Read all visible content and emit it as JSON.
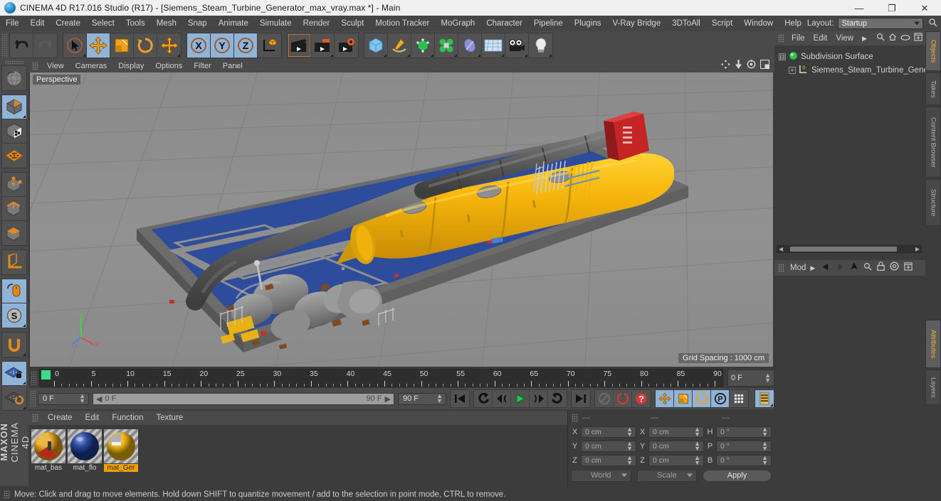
{
  "window": {
    "title": "CINEMA 4D R17.016 Studio (R17) - [Siemens_Steam_Turbine_Generator_max_vray.max *] - Main",
    "minimize": "—",
    "maximize": "❐",
    "close": "✕"
  },
  "menubar": {
    "items": [
      {
        "label": "File"
      },
      {
        "label": "Edit"
      },
      {
        "label": "Create"
      },
      {
        "label": "Select"
      },
      {
        "label": "Tools"
      },
      {
        "label": "Mesh"
      },
      {
        "label": "Snap"
      },
      {
        "label": "Animate"
      },
      {
        "label": "Simulate"
      },
      {
        "label": "Render"
      },
      {
        "label": "Sculpt"
      },
      {
        "label": "Motion Tracker"
      },
      {
        "label": "MoGraph"
      },
      {
        "label": "Character"
      },
      {
        "label": "Pipeline"
      },
      {
        "label": "Plugins"
      },
      {
        "label": "V-Ray Bridge"
      },
      {
        "label": "3DToAll"
      },
      {
        "label": "Script"
      },
      {
        "label": "Window"
      },
      {
        "label": "Help"
      }
    ],
    "layout_label": "Layout:",
    "layout_value": "Startup",
    "search_icon": "search-icon"
  },
  "toolbar": {
    "groups": [
      {
        "buttons": [
          {
            "name": "undo-button",
            "icon": "undo-arrow-icon",
            "state": "normal"
          },
          {
            "name": "redo-button",
            "icon": "redo-arrow-icon",
            "state": "disabled"
          }
        ]
      },
      {
        "buttons": [
          {
            "name": "live-selection-tool",
            "icon": "cursor-selection-icon",
            "state": "active-outline"
          },
          {
            "name": "move-tool",
            "icon": "move-arrows-icon",
            "state": "selected"
          },
          {
            "name": "scale-tool",
            "icon": "scale-box-icon",
            "state": "normal"
          },
          {
            "name": "rotate-tool",
            "icon": "rotate-ring-icon",
            "state": "normal"
          },
          {
            "name": "move-alt-tool",
            "icon": "move-arrows-icon",
            "state": "normal"
          }
        ]
      },
      {
        "buttons": [
          {
            "name": "x-axis-lock",
            "icon": "x-axis-icon",
            "state": "selected",
            "label": "X"
          },
          {
            "name": "y-axis-lock",
            "icon": "y-axis-icon",
            "state": "selected",
            "label": "Y"
          },
          {
            "name": "z-axis-lock",
            "icon": "z-axis-icon",
            "state": "selected",
            "label": "Z"
          },
          {
            "name": "world-object-coordinate-toggle",
            "icon": "world-axis-cube-icon",
            "state": "normal"
          }
        ]
      },
      {
        "buttons": [
          {
            "name": "render-view-button",
            "icon": "clapperboard-icon",
            "state": "outline"
          },
          {
            "name": "render-to-picture-viewer-button",
            "icon": "clapperboard-red-icon",
            "state": "normal"
          },
          {
            "name": "render-settings-button",
            "icon": "clapperboard-gear-icon",
            "state": "normal"
          }
        ]
      },
      {
        "buttons": [
          {
            "name": "add-cube-object-button",
            "icon": "blue-cube-icon",
            "state": "normal"
          },
          {
            "name": "add-spline-button",
            "icon": "pen-spline-icon",
            "state": "normal"
          },
          {
            "name": "add-generator-button",
            "icon": "green-cube-icon",
            "state": "normal"
          },
          {
            "name": "add-mograph-button",
            "icon": "green-cluster-icon",
            "state": "normal"
          },
          {
            "name": "add-deformer-button",
            "icon": "bend-deformer-icon",
            "state": "normal"
          },
          {
            "name": "add-environment-button",
            "icon": "floor-grid-icon",
            "state": "normal"
          },
          {
            "name": "add-camera-button",
            "icon": "camera-icon",
            "state": "normal"
          },
          {
            "name": "add-light-button",
            "icon": "lightbulb-icon",
            "state": "normal"
          }
        ]
      }
    ]
  },
  "lefttoolbar": {
    "groups": [
      {
        "buttons": [
          {
            "name": "undo-view-button",
            "icon": "globe-undo-icon",
            "state": "normal"
          }
        ]
      },
      {
        "buttons": [
          {
            "name": "model-mode-button",
            "icon": "model-cube-icon",
            "state": "selected"
          },
          {
            "name": "texture-mode-button",
            "icon": "texture-cube-icon",
            "state": "normal"
          },
          {
            "name": "workplane-mode-button",
            "icon": "workplane-grid-icon",
            "state": "normal"
          }
        ]
      },
      {
        "buttons": [
          {
            "name": "points-mode-button",
            "icon": "points-cube-icon",
            "state": "normal"
          },
          {
            "name": "edges-mode-button",
            "icon": "edges-cube-icon",
            "state": "normal"
          },
          {
            "name": "polygons-mode-button",
            "icon": "polygons-cube-icon",
            "state": "normal"
          }
        ]
      },
      {
        "buttons": [
          {
            "name": "object-axis-mode-button",
            "icon": "axis-corner-icon",
            "state": "normal"
          }
        ]
      },
      {
        "buttons": [
          {
            "name": "enable-axis-modification-button",
            "icon": "mouse-axis-icon",
            "state": "selected"
          },
          {
            "name": "soft-selection-button",
            "icon": "s-circle-icon",
            "state": "selected"
          }
        ]
      },
      {
        "buttons": [
          {
            "name": "snap-magnet-button",
            "icon": "magnet-icon",
            "state": "normal"
          }
        ]
      },
      {
        "buttons": [
          {
            "name": "lock-workplane-button",
            "icon": "workplane-lock-icon",
            "state": "selected"
          },
          {
            "name": "workplane-rotate-button",
            "icon": "workplane-rotate-icon",
            "state": "normal"
          }
        ]
      }
    ],
    "brand_top": "MAXON",
    "brand_bottom": "CINEMA 4D"
  },
  "viewport": {
    "menu": [
      {
        "label": "View"
      },
      {
        "label": "Cameras"
      },
      {
        "label": "Display"
      },
      {
        "label": "Options"
      },
      {
        "label": "Filter"
      },
      {
        "label": "Panel"
      }
    ],
    "icons": [
      {
        "name": "pan-view-icon"
      },
      {
        "name": "dolly-view-icon"
      },
      {
        "name": "orbit-view-icon"
      },
      {
        "name": "maximize-view-icon"
      }
    ],
    "label": "Perspective",
    "grid_spacing": "Grid Spacing : 1000 cm",
    "axis": {
      "x": "X",
      "y": "Y",
      "z": "Z"
    },
    "scene": {
      "model_name": "Siemens Steam Turbine Generator",
      "platform_color": "#2d4a96",
      "turbine_color": "#f5b60f",
      "pipe_color": "#5a5a5a",
      "background_color": "#8d8d8d",
      "accent_color": "#cc2222"
    }
  },
  "timeline": {
    "grip": "drag-grip",
    "range_start": 0,
    "range_end": 90,
    "major_ticks": [
      0,
      5,
      10,
      15,
      20,
      25,
      30,
      35,
      40,
      45,
      50,
      55,
      60,
      65,
      70,
      75,
      80,
      85,
      90
    ],
    "current_frame_field": "0 F"
  },
  "transport": {
    "current_frame": "0 F",
    "slider_start": "0 F",
    "slider_end": "90 F",
    "end_frame": "90 F",
    "buttons": [
      {
        "name": "go-to-start-button",
        "icon": "skip-to-start-icon",
        "state": "normal"
      },
      {
        "name": "go-to-previous-key-button",
        "icon": "rewind-key-icon",
        "state": "normal"
      },
      {
        "name": "go-to-previous-frame-button",
        "icon": "step-back-icon",
        "state": "normal"
      },
      {
        "name": "play-button",
        "icon": "play-triangle-icon",
        "state": "normal"
      },
      {
        "name": "go-to-next-frame-button",
        "icon": "step-forward-icon",
        "state": "normal"
      },
      {
        "name": "go-to-next-key-button",
        "icon": "forward-key-icon",
        "state": "normal"
      },
      {
        "name": "go-to-end-button",
        "icon": "skip-to-end-icon",
        "state": "normal"
      },
      {
        "name": "record-active-objects-button",
        "icon": "record-disabled-icon",
        "state": "disabled"
      },
      {
        "name": "autokeying-button",
        "icon": "autokey-red-icon",
        "state": "normal"
      },
      {
        "name": "keyframe-selection-button",
        "icon": "question-red-icon",
        "state": "normal"
      },
      {
        "name": "position-key-button",
        "icon": "position-arrows-icon",
        "state": "selected"
      },
      {
        "name": "scale-key-button",
        "icon": "scale-key-icon",
        "state": "selected"
      },
      {
        "name": "rotation-key-button",
        "icon": "rotation-key-icon",
        "state": "selected"
      },
      {
        "name": "parameter-key-button",
        "icon": "p-circle-icon",
        "state": "selected"
      },
      {
        "name": "point-level-animation-button",
        "icon": "pla-dots-icon",
        "state": "normal"
      },
      {
        "name": "timeline-button",
        "icon": "timeline-strip-icon",
        "state": "selected"
      }
    ]
  },
  "material_manager": {
    "menu": [
      {
        "label": "Create"
      },
      {
        "label": "Edit"
      },
      {
        "label": "Function"
      },
      {
        "label": "Texture"
      }
    ],
    "materials": [
      {
        "name": "mat_bas",
        "full_name": "mat_base",
        "color": "#e0a028",
        "selected": false
      },
      {
        "name": "mat_flo",
        "full_name": "mat_floor",
        "color": "#2e4b9e",
        "selected": false
      },
      {
        "name": "mat_Ger",
        "full_name": "mat_Generator",
        "color": "#e8b014",
        "selected": true
      }
    ]
  },
  "coordinates": {
    "headers": [
      "—",
      "—",
      "—"
    ],
    "rows": [
      {
        "l1": "X",
        "v1": "0 cm",
        "l2": "X",
        "v2": "0 cm",
        "l3": "H",
        "v3": "0 °"
      },
      {
        "l1": "Y",
        "v1": "0 cm",
        "l2": "Y",
        "v2": "0 cm",
        "l3": "P",
        "v3": "0 °"
      },
      {
        "l1": "Z",
        "v1": "0 cm",
        "l2": "Z",
        "v2": "0 cm",
        "l3": "B",
        "v3": "0 °"
      }
    ],
    "system": "World",
    "mode": "Scale",
    "apply": "Apply"
  },
  "object_manager": {
    "menu": [
      {
        "label": "File"
      },
      {
        "label": "Edit"
      },
      {
        "label": "View"
      }
    ],
    "arrow": "▶",
    "icons": [
      {
        "name": "search-icon"
      },
      {
        "name": "home-icon"
      },
      {
        "name": "link-icon"
      },
      {
        "name": "add-layer-icon"
      }
    ],
    "tree": [
      {
        "label": "Subdivision Surface",
        "icon": "subdivision-surface-icon",
        "depth": 0
      },
      {
        "label": "Siemens_Steam_Turbine_General",
        "icon": "polygon-object-icon",
        "depth": 1
      }
    ]
  },
  "attribute_manager": {
    "mode_label": "Mod",
    "arrow": "▶",
    "icons": [
      {
        "name": "back-arrow-icon"
      },
      {
        "name": "forward-arrow-icon"
      },
      {
        "name": "up-arrow-icon"
      },
      {
        "name": "search-icon"
      },
      {
        "name": "lock-icon"
      },
      {
        "name": "target-icon"
      },
      {
        "name": "add-icon"
      }
    ]
  },
  "tabstrip": {
    "upper": [
      {
        "label": "Objects",
        "active": true
      },
      {
        "label": "Takes",
        "active": false
      },
      {
        "label": "Content Browser",
        "active": false
      },
      {
        "label": "Structure",
        "active": false
      }
    ],
    "lower": [
      {
        "label": "Attributes",
        "active": true
      },
      {
        "label": "Layers",
        "active": false
      }
    ]
  },
  "statusbar": {
    "message": "Move: Click and drag to move elements. Hold down SHIFT to quantize movement / add to the selection in point mode, CTRL to remove."
  }
}
